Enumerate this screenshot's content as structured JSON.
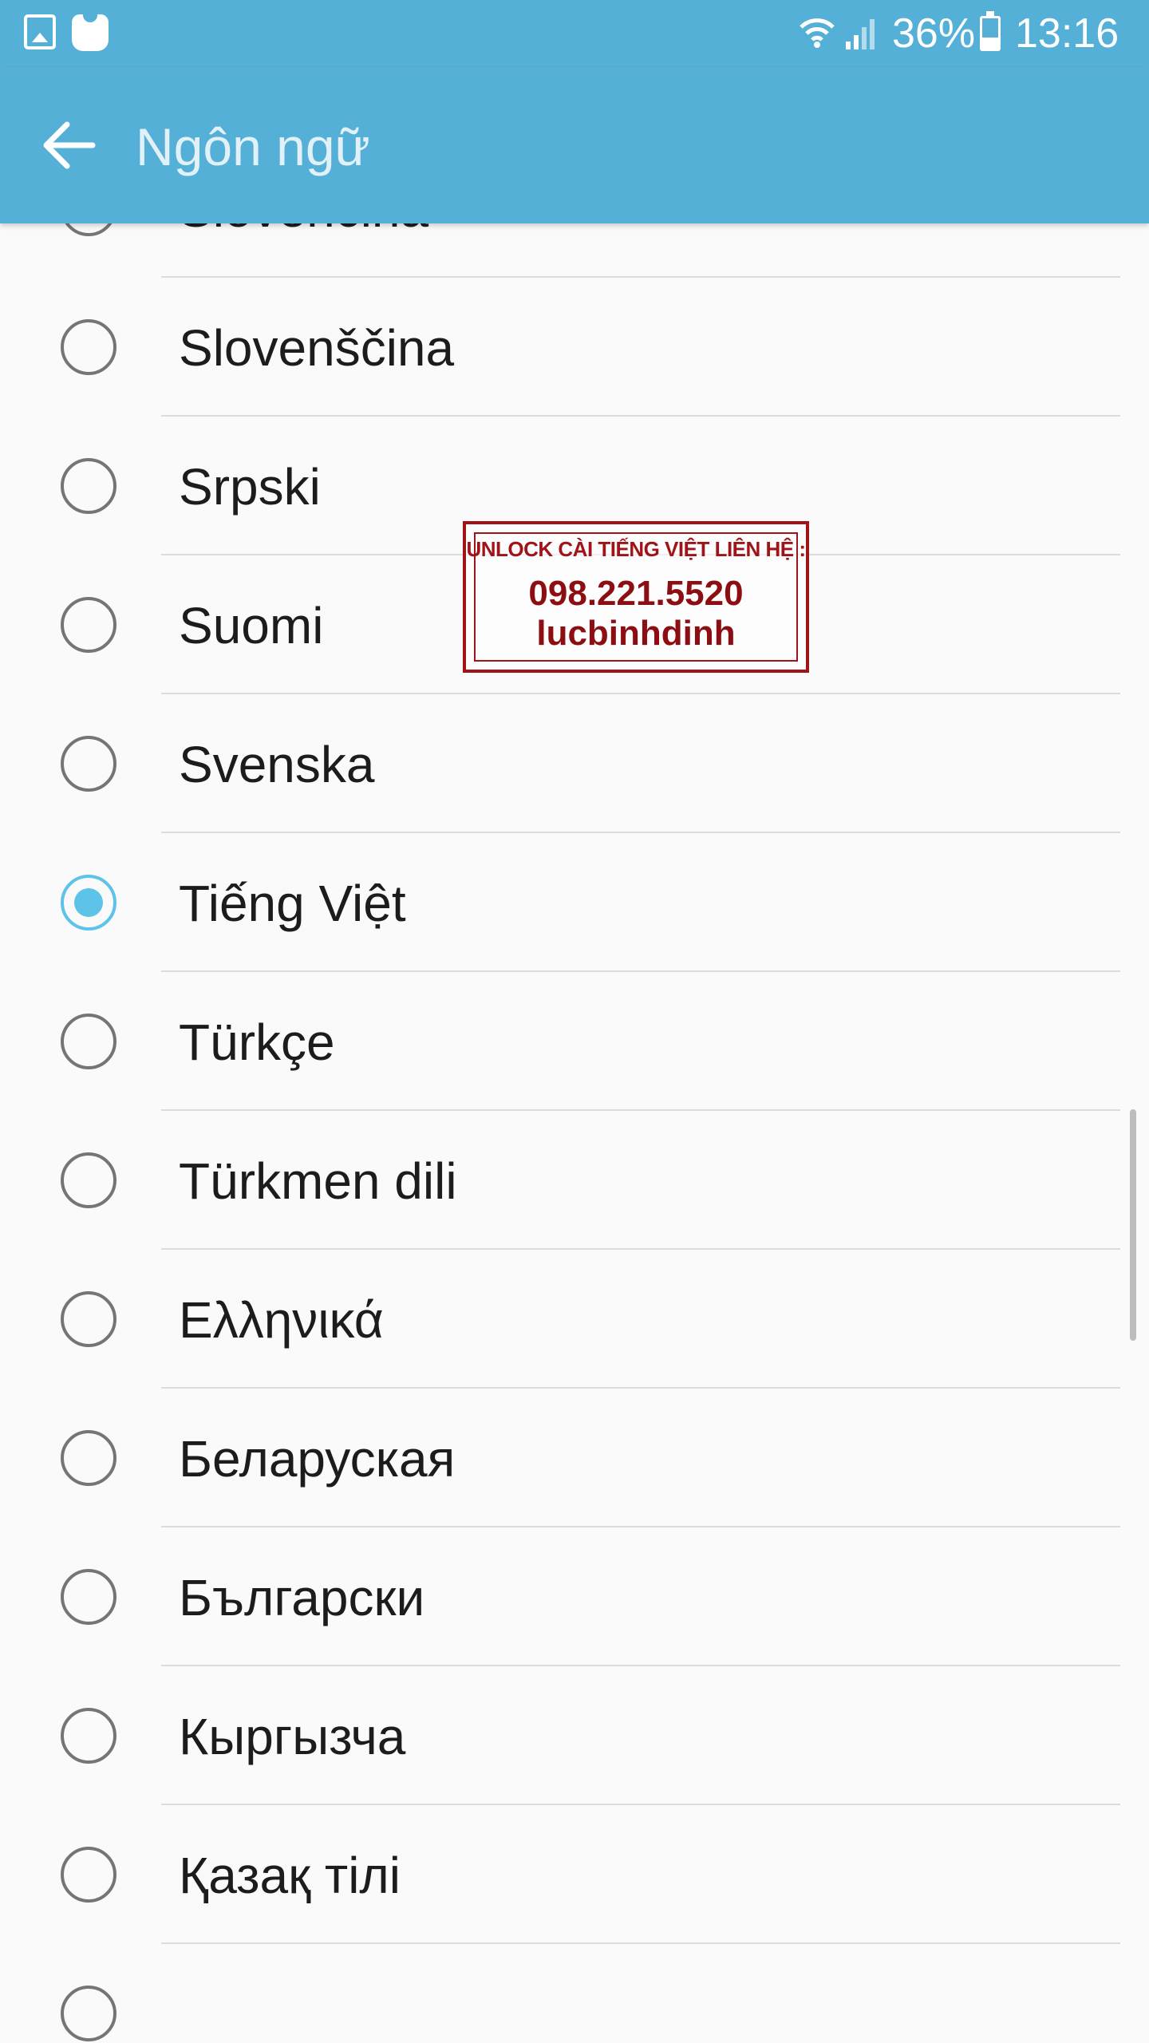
{
  "status_bar": {
    "battery_text": "36%",
    "battery_level": 0.36,
    "time": "13:16",
    "icons": [
      "gallery-icon",
      "galaxy-apps-icon",
      "wifi-icon",
      "signal-icon",
      "battery-icon"
    ]
  },
  "app_bar": {
    "title": "Ngôn ngữ",
    "color": "#55b0d8",
    "back_icon": "arrow-left-icon"
  },
  "languages": [
    {
      "label": "Slovenčina",
      "selected": false
    },
    {
      "label": "Slovenščina",
      "selected": false
    },
    {
      "label": "Srpski",
      "selected": false
    },
    {
      "label": "Suomi",
      "selected": false
    },
    {
      "label": "Svenska",
      "selected": false
    },
    {
      "label": "Tiếng Việt",
      "selected": true
    },
    {
      "label": "Türkçe",
      "selected": false
    },
    {
      "label": "Türkmen dili",
      "selected": false
    },
    {
      "label": "Ελληνικά",
      "selected": false
    },
    {
      "label": "Беларуская",
      "selected": false
    },
    {
      "label": "Български",
      "selected": false
    },
    {
      "label": "Кыргызча",
      "selected": false
    },
    {
      "label": "Қазақ тілі",
      "selected": false
    },
    {
      "label": "",
      "selected": false
    }
  ],
  "accent_color": "#5ec3e8",
  "watermark": {
    "line1": "UNLOCK CÀI TIẾNG VIỆT LIÊN HỆ :",
    "line2": "098.221.5520",
    "line3": "lucbinhdinh"
  }
}
